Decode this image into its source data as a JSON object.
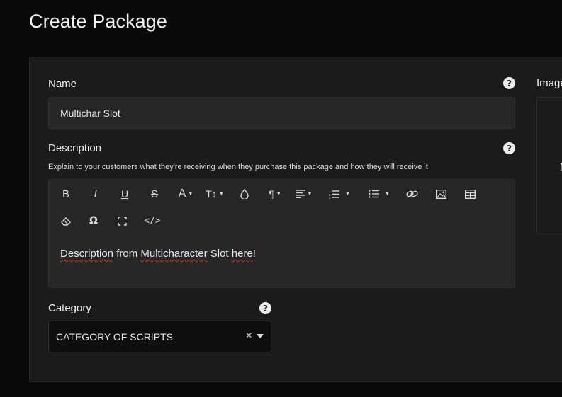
{
  "page": {
    "title": "Create Package"
  },
  "name_field": {
    "label": "Name",
    "value": "Multichar Slot",
    "help": "?"
  },
  "description_field": {
    "label": "Description",
    "hint": "Explain to your customers what they're receiving when they purchase this package and how they will receive it",
    "help": "?",
    "content_parts": [
      "Description",
      " from ",
      "Multicharacter",
      " Slot ",
      "here",
      "!"
    ]
  },
  "editor_toolbar": {
    "row1": [
      "bold-icon",
      "italic-icon",
      "underline-icon",
      "strikethrough-icon",
      "font-color-icon",
      "font-size-icon",
      "color-drop-icon",
      "paragraph-icon",
      "align-icon",
      "ordered-list-icon",
      "unordered-list-icon",
      "link-icon",
      "image-icon",
      "table-icon"
    ],
    "row2": [
      "eraser-icon",
      "omega-icon",
      "fullscreen-icon",
      "code-icon"
    ]
  },
  "category_field": {
    "label": "Category",
    "value": "CATEGORY OF SCRIPTS",
    "help": "?",
    "clear": "×"
  },
  "image_field": {
    "label": "Image",
    "placeholder_clip": "N"
  }
}
